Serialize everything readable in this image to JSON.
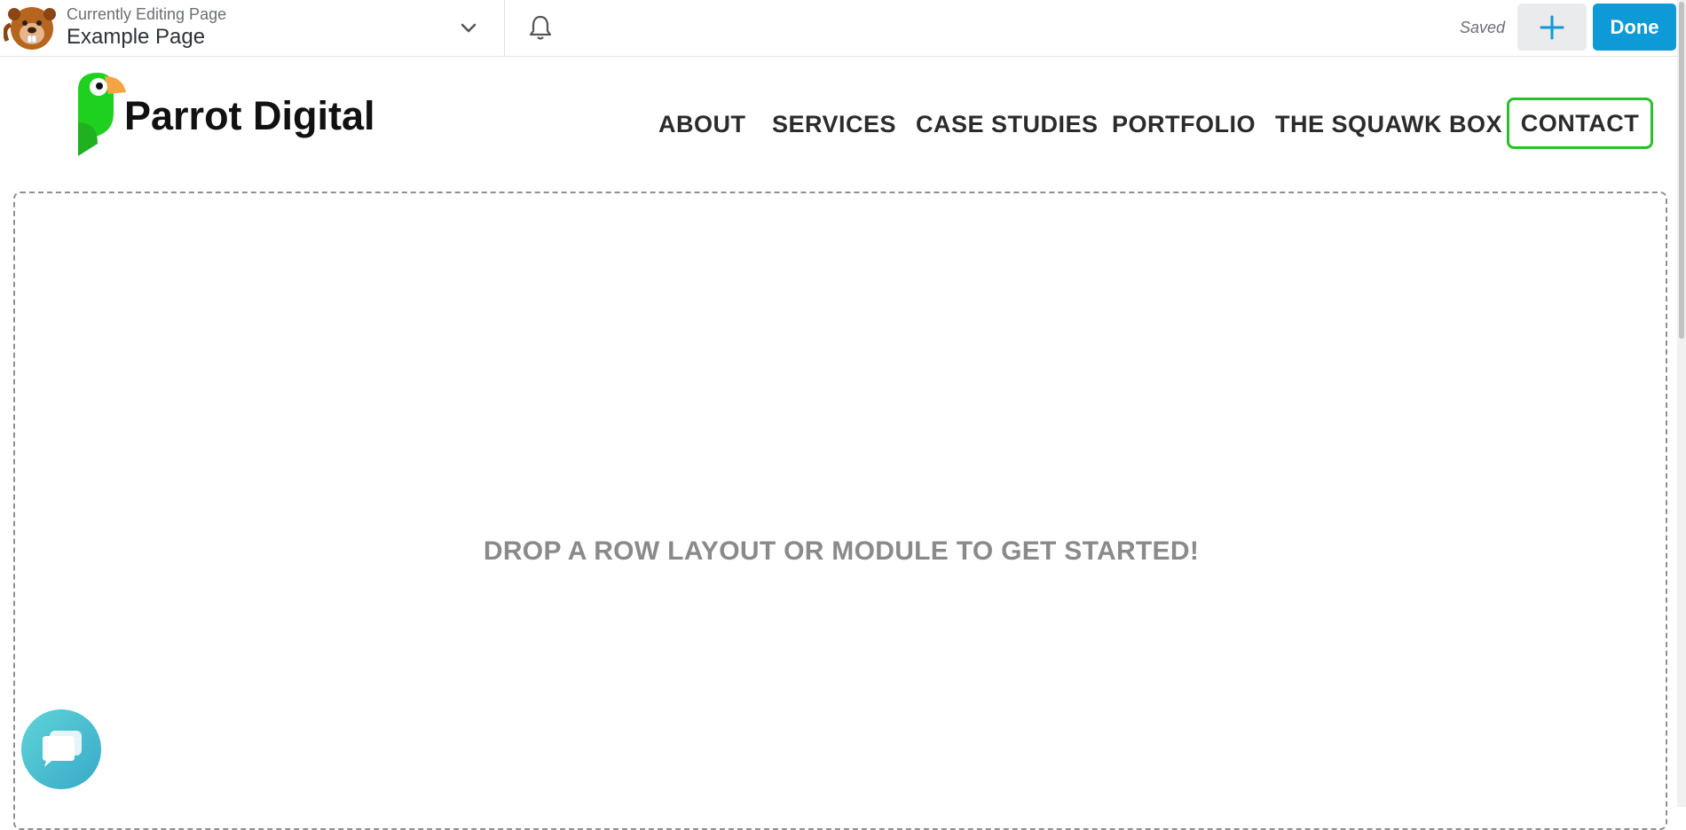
{
  "builder": {
    "currently_editing_label": "Currently Editing Page",
    "page_name": "Example Page",
    "saved_status": "Saved",
    "done_label": "Done",
    "accent_color": "#0e9ad6"
  },
  "site": {
    "brand_name": "Parrot Digital",
    "brand_color": "#2bbf2b",
    "nav": [
      {
        "label": "ABOUT"
      },
      {
        "label": "SERVICES"
      },
      {
        "label": "CASE STUDIES"
      },
      {
        "label": "PORTFOLIO"
      },
      {
        "label": "THE SQUAWK BOX"
      }
    ],
    "contact_label": "CONTACT"
  },
  "canvas": {
    "drop_message": "DROP A ROW LAYOUT OR MODULE TO GET STARTED!"
  },
  "icons": {
    "builder_logo": "beaver-icon",
    "page_select": "chevron-down-icon",
    "notifications": "bell-icon",
    "add": "plus-icon",
    "chat": "chat-bubble-icon"
  }
}
